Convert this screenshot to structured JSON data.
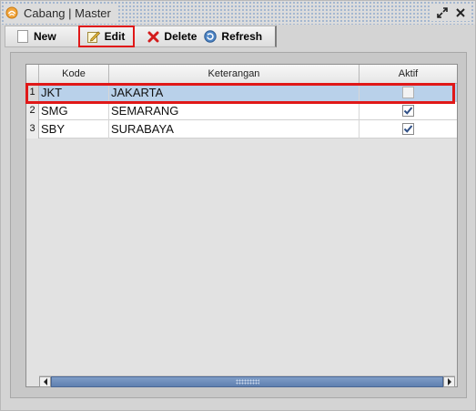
{
  "window": {
    "title": "Cabang | Master"
  },
  "toolbar": {
    "new_label": "New",
    "edit_label": "Edit",
    "delete_label": "Delete",
    "refresh_label": "Refresh"
  },
  "table": {
    "columns": {
      "kode": "Kode",
      "keterangan": "Keterangan",
      "aktif": "Aktif"
    },
    "rows": [
      {
        "num": "1",
        "kode": "JKT",
        "keterangan": "JAKARTA",
        "aktif": false,
        "selected": true
      },
      {
        "num": "2",
        "kode": "SMG",
        "keterangan": "SEMARANG",
        "aktif": true,
        "selected": false
      },
      {
        "num": "3",
        "kode": "SBY",
        "keterangan": "SURABAYA",
        "aktif": true,
        "selected": false
      }
    ]
  },
  "colors": {
    "selection": "#b9d1ea",
    "highlight_outline": "#e01818",
    "scroll_thumb": "#6f8fbd"
  },
  "icons": {
    "app": "app-swirl-icon",
    "restore": "restore-icon",
    "close": "close-icon",
    "new": "new-document-icon",
    "edit": "edit-pencil-icon",
    "delete": "delete-x-icon",
    "refresh": "refresh-icon"
  }
}
